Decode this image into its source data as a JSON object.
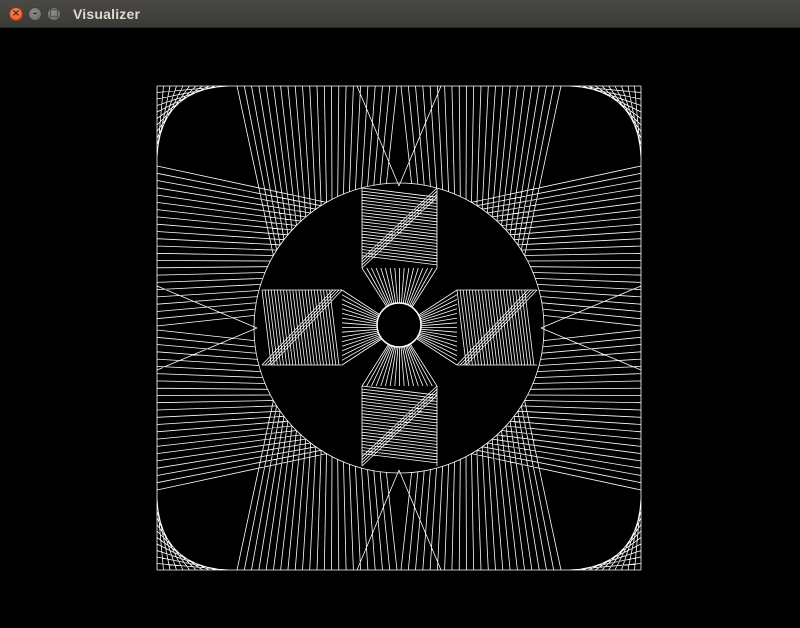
{
  "window": {
    "title": "Visualizer",
    "controls": {
      "close": "×",
      "minimize": "–",
      "maximize": "□"
    }
  },
  "canvas": {
    "background": "#000000",
    "stroke": "#ffffff",
    "pattern": "string-art mandala: square frame, circle, cross of hatched bars, small center circle"
  }
}
